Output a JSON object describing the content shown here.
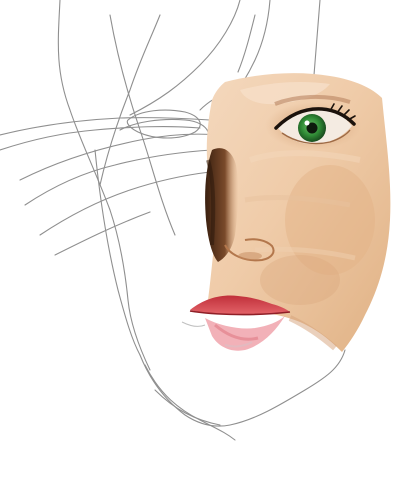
{
  "canvas": {
    "background": "#ffffff"
  },
  "palette": {
    "sketch_line": "#8f8f8f",
    "skin_light": "#f2d3b4",
    "skin_mid": "#e4b98f",
    "skin_shadow": "#c8946a",
    "shadow_dark": "#4a2a16",
    "iris": "#2f8a35",
    "lash": "#1b120c",
    "lip": "#d13b40",
    "lip_light": "#f0a3ab"
  },
  "subjects": [
    "pencil-sketch-outline",
    "painted-face-half",
    "green-eye",
    "red-lips"
  ]
}
